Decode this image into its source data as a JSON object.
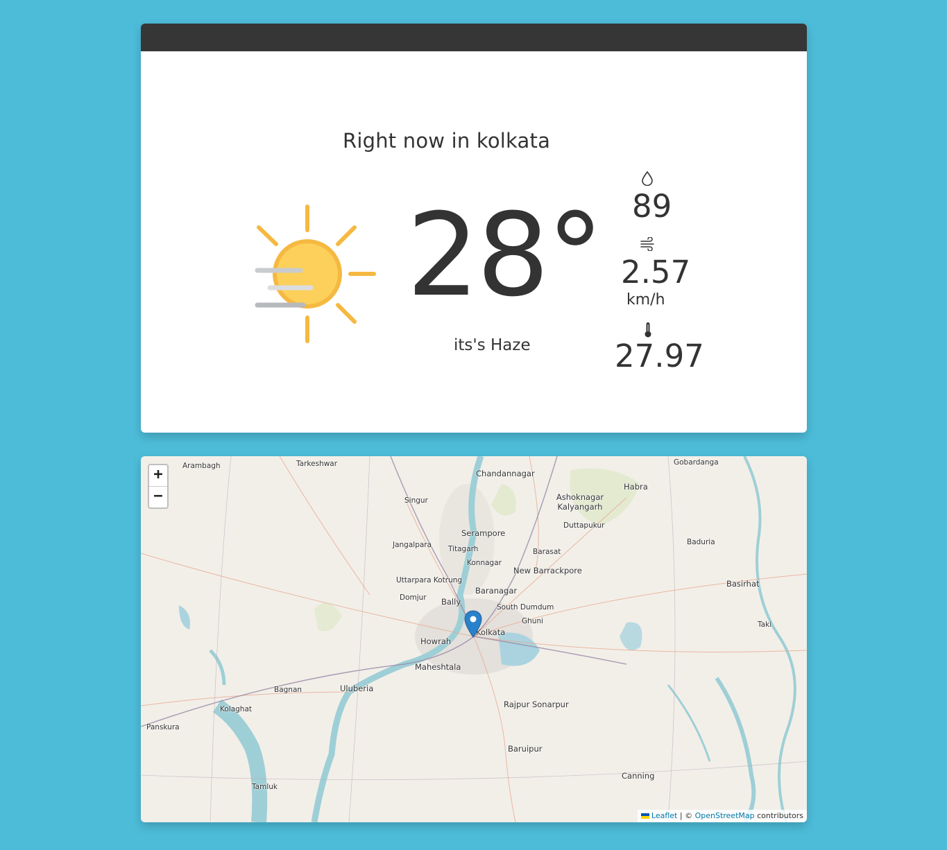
{
  "weather": {
    "title": "Right now in kolkata",
    "temperature": "28°",
    "description": "its's Haze",
    "humidity": "89",
    "wind_speed": "2.57",
    "wind_unit": "km/h",
    "feels_like": "27.97",
    "condition_icon": "sun-haze-icon",
    "colors": {
      "sun": "#f7c744",
      "sun_rays": "#f5b941",
      "haze": "#c6c8cc",
      "header": "#363636",
      "background": "#4dbcd9"
    }
  },
  "map": {
    "zoom_in": "+",
    "zoom_out": "−",
    "attribution": {
      "leaflet": "Leaflet",
      "separator": " | © ",
      "osm": "OpenStreetMap",
      "suffix": " contributors"
    },
    "places": [
      "Arambagh",
      "Tarkeshwar",
      "Chandannagar",
      "Gobardanga",
      "Habra",
      "Singur",
      "Ashoknagar Kalyangarh",
      "Duttapukur",
      "Serampore",
      "Jangalpara",
      "Titagarh",
      "Baduria",
      "Barasat",
      "Konnagar",
      "New Barrackpore",
      "Basirhat",
      "Uttarpara Kotrung",
      "Baranagar",
      "Domjur",
      "Bally",
      "South Dumdum",
      "Ghuni",
      "Taki",
      "Kolkata",
      "Howrah",
      "Maheshtala",
      "Bagnan",
      "Uluberia",
      "Kolaghat",
      "Rajpur Sonarpur",
      "Panskura",
      "Baruipur",
      "Canning",
      "Tamluk"
    ]
  }
}
